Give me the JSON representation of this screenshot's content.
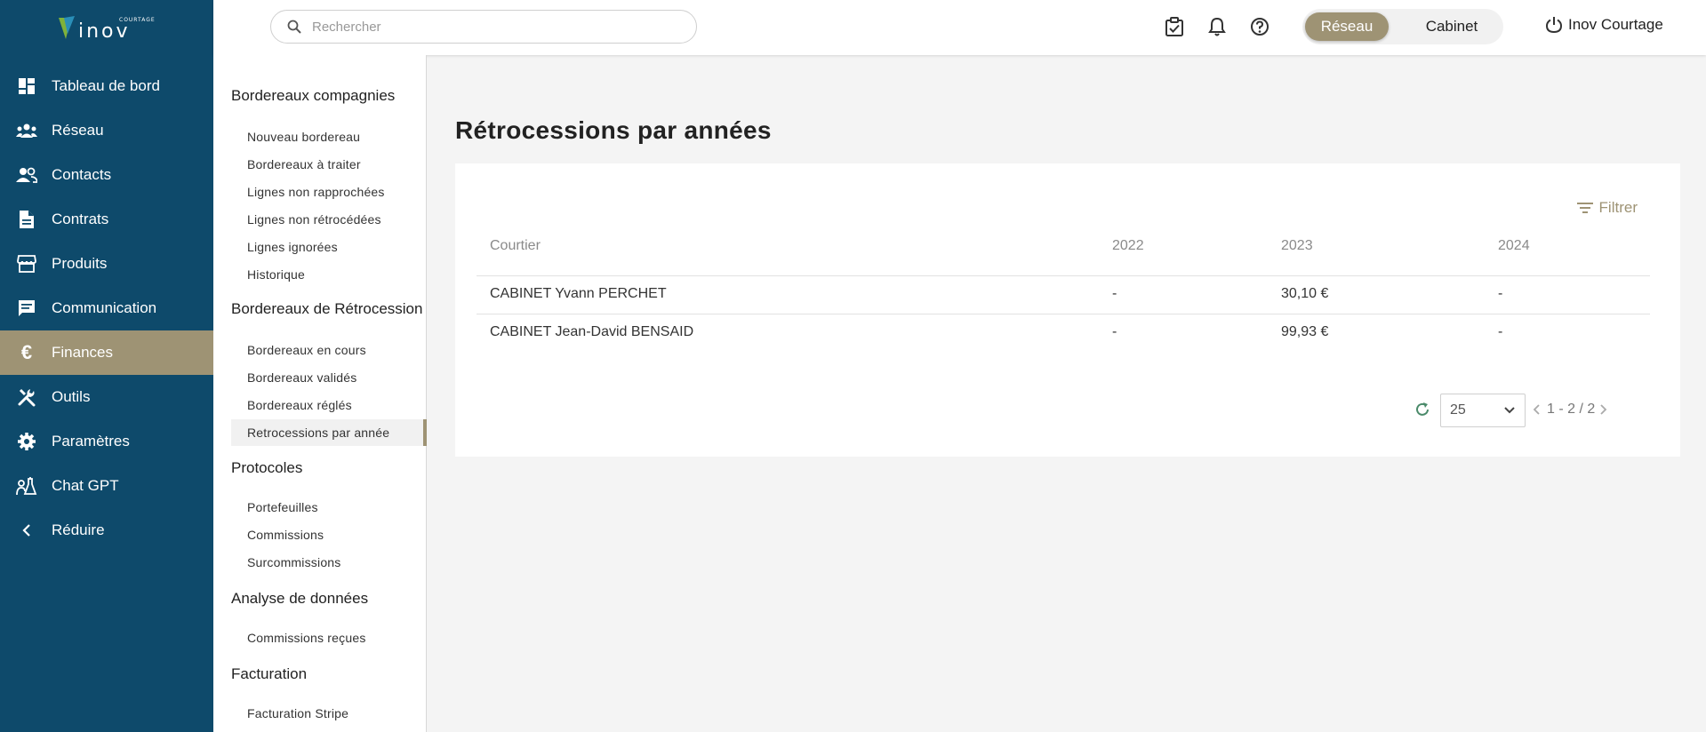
{
  "brand": {
    "logo_text": "inov",
    "logo_small": "COURTAGE"
  },
  "sidebar": {
    "items": [
      {
        "label": "Tableau de bord",
        "icon": "dashboard-icon"
      },
      {
        "label": "Réseau",
        "icon": "network-icon"
      },
      {
        "label": "Contacts",
        "icon": "contacts-icon"
      },
      {
        "label": "Contrats",
        "icon": "document-icon"
      },
      {
        "label": "Produits",
        "icon": "store-icon"
      },
      {
        "label": "Communication",
        "icon": "message-icon"
      },
      {
        "label": "Finances",
        "icon": "euro-icon",
        "active": true
      },
      {
        "label": "Outils",
        "icon": "tools-icon"
      },
      {
        "label": "Paramètres",
        "icon": "gear-icon"
      },
      {
        "label": "Chat GPT",
        "icon": "science-icon"
      },
      {
        "label": "Réduire",
        "icon": "chevron-left-icon"
      }
    ]
  },
  "header": {
    "search_placeholder": "Rechercher",
    "toggle": {
      "reseau": "Réseau",
      "cabinet": "Cabinet",
      "selected": "Réseau"
    },
    "user_label": "Inov Courtage"
  },
  "submenu": {
    "sections": [
      {
        "title": "Bordereaux compagnies",
        "links": [
          "Nouveau bordereau",
          "Bordereaux à traiter",
          "Lignes non rapprochées",
          "Lignes non rétrocédées",
          "Lignes ignorées",
          "Historique"
        ]
      },
      {
        "title": "Bordereaux de Rétrocession",
        "links": [
          "Bordereaux en cours",
          "Bordereaux validés",
          "Bordereaux réglés",
          "Retrocessions par année"
        ]
      },
      {
        "title": "Protocoles",
        "links": [
          "Portefeuilles",
          "Commissions",
          "Surcommissions"
        ]
      },
      {
        "title": "Analyse de données",
        "links": [
          "Commissions reçues"
        ]
      },
      {
        "title": "Facturation",
        "links": [
          "Facturation Stripe"
        ]
      }
    ],
    "active_link": "Retrocessions par année"
  },
  "main": {
    "title": "Rétrocessions par années",
    "filter_label": "Filtrer",
    "table": {
      "columns": [
        "Courtier",
        "2022",
        "2023",
        "2024"
      ],
      "rows": [
        [
          "CABINET Yvann PERCHET",
          "-",
          "30,10 €",
          "-"
        ],
        [
          "CABINET Jean-David BENSAID",
          "-",
          "99,93 €",
          "-"
        ]
      ]
    },
    "pagination": {
      "page_size": "25",
      "range": "1 - 2 / 2"
    }
  },
  "colors": {
    "sidebar_bg": "#0e4a6b",
    "accent": "#9e9374"
  }
}
